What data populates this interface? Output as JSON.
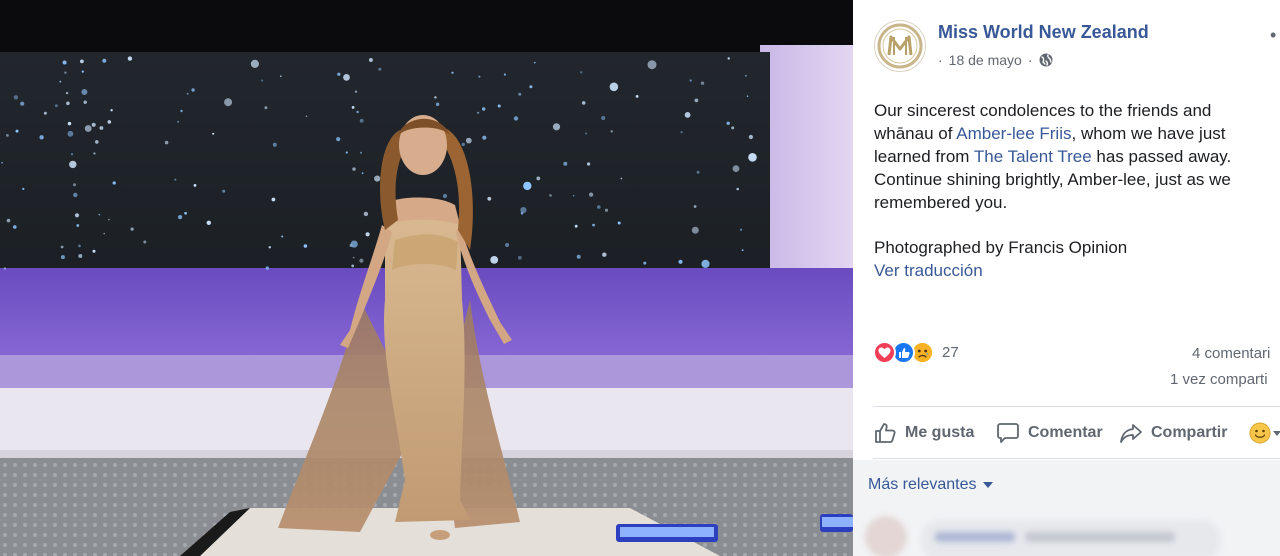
{
  "post": {
    "page_name": "Miss World New Zealand",
    "date_prefix": "·",
    "date": "18 de mayo",
    "date_suffix": "·",
    "text_1": "Our sincerest condolences to the friends and whānau of ",
    "link_1": "Amber-lee Friis",
    "text_2": ", whom we have just learned from ",
    "link_2": "The Talent Tree",
    "text_3": " has passed away. Continue shining brightly, Amber-lee, just as we remembered you.",
    "credit": "Photographed by Francis Opinion",
    "translate": "Ver traducción"
  },
  "engagement": {
    "reaction_count": "27",
    "comments": "4 comentari",
    "shares": "1 vez comparti"
  },
  "actions": {
    "like": "Me gusta",
    "comment": "Comentar",
    "share": "Compartir"
  },
  "comments": {
    "sort_label": "Más relevantes"
  },
  "icons": {
    "avatar": "miss-world-logo-icon",
    "privacy": "globe-icon",
    "reactions": [
      "love-icon",
      "like-icon",
      "sad-icon"
    ],
    "actions": [
      "thumbs-up-icon",
      "speech-bubble-icon",
      "share-arrow-icon",
      "smiley-icon"
    ]
  },
  "colors": {
    "link": "#385898",
    "muted": "#606770",
    "love": "#f33e58",
    "like": "#1877f2",
    "sad": "#f7b125"
  }
}
